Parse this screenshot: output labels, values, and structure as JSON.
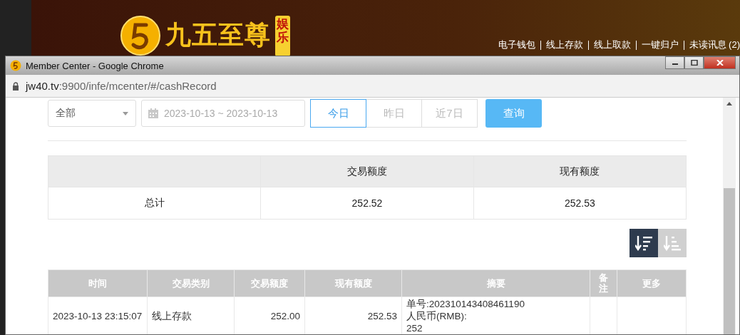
{
  "banner": {
    "logo_text": "九五至尊",
    "badge": "娱乐",
    "nav": [
      {
        "label": "电子钱包"
      },
      {
        "label": "线上存款"
      },
      {
        "label": "线上取款"
      },
      {
        "label": "一键归户"
      },
      {
        "label": "未读讯息 (2)"
      }
    ]
  },
  "window": {
    "title": "Member Center - Google Chrome",
    "url_host": "jw40.tv",
    "url_path": ":9900/infe/mcenter/#/cashRecord"
  },
  "filter": {
    "type_select": "全部",
    "date_range": "2023-10-13 ~ 2023-10-13",
    "ranges": [
      {
        "label": "今日",
        "selected": true
      },
      {
        "label": "昨日",
        "selected": false
      },
      {
        "label": "近7日",
        "selected": false
      }
    ],
    "query_button": "查询"
  },
  "summary": {
    "columns": [
      "",
      "交易额度",
      "现有额度"
    ],
    "rows": [
      [
        "总计",
        "252.52",
        "252.53"
      ]
    ]
  },
  "sort_buttons": [
    {
      "kind": "desc",
      "selected": true
    },
    {
      "kind": "asc",
      "selected": false
    }
  ],
  "table": {
    "columns": [
      "时间",
      "交易类别",
      "交易额度",
      "现有额度",
      "摘要",
      "备注",
      "更多"
    ],
    "rows": [
      {
        "cells": [
          "2023-10-13 23:15:07",
          "线上存款",
          "252.00",
          "252.53",
          "单号:202310143408461190\n人民币(RMB):\n252",
          "",
          ""
        ]
      }
    ]
  }
}
